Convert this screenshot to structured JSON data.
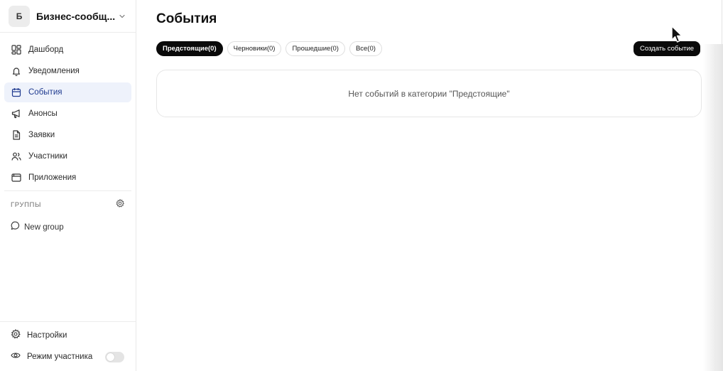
{
  "workspace": {
    "avatar_letter": "Б",
    "name": "Бизнес-сообщ..."
  },
  "nav": {
    "items": [
      {
        "label": "Дашборд",
        "icon": "dashboard-icon"
      },
      {
        "label": "Уведомления",
        "icon": "bell-icon"
      },
      {
        "label": "События",
        "icon": "calendar-icon",
        "active": true
      },
      {
        "label": "Анонсы",
        "icon": "megaphone-icon"
      },
      {
        "label": "Заявки",
        "icon": "document-icon"
      },
      {
        "label": "Участники",
        "icon": "users-icon"
      },
      {
        "label": "Приложения",
        "icon": "apps-window-icon"
      }
    ]
  },
  "groups": {
    "title": "ГРУППЫ",
    "items": [
      {
        "label": "New group",
        "icon": "chat-bubble-icon"
      }
    ]
  },
  "bottom": {
    "settings_label": "Настройки",
    "participant_mode_label": "Режим участника",
    "participant_mode_on": false
  },
  "main": {
    "title": "События",
    "tabs": [
      {
        "label": "Предстоящие(0)",
        "active": true
      },
      {
        "label": "Черновики(0)"
      },
      {
        "label": "Прошедшие(0)"
      },
      {
        "label": "Все(0)"
      }
    ],
    "create_button": "Создать событие",
    "empty_message": "Нет событий в категории \"Предстоящие\""
  },
  "colors": {
    "accent": "#1f3a8f",
    "active_bg": "#eef2fb",
    "primary_btn": "#0a0a0a"
  }
}
